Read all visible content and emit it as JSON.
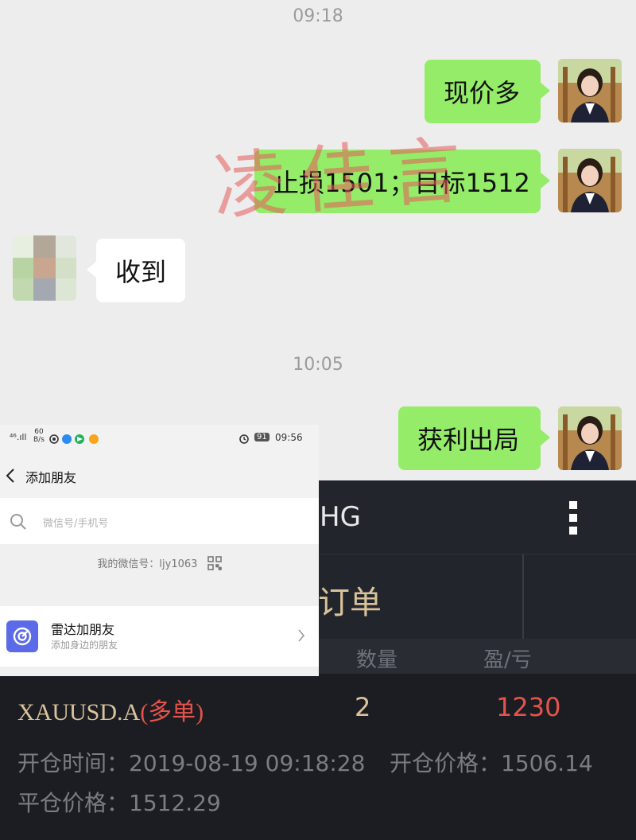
{
  "chat": {
    "time1": "09:18",
    "time2": "10:05",
    "messages": [
      {
        "side": "right",
        "text": "现价多"
      },
      {
        "side": "right",
        "text": "止损1501；目标1512"
      },
      {
        "side": "left",
        "text": "收到"
      },
      {
        "side": "right",
        "text": "获利出局"
      }
    ],
    "watermark": "凌佳言"
  },
  "phone": {
    "status": {
      "signal": "⁴⁶.ıll",
      "speed": "60",
      "speed_unit": "B/s",
      "battery": "91",
      "time": "09:56"
    },
    "nav_title": "添加朋友",
    "search_placeholder": "微信号/手机号",
    "my_wechat": "我的微信号：ljy1063",
    "radar": {
      "title": "雷达加朋友",
      "subtitle": "添加身边的朋友"
    }
  },
  "trade": {
    "header_partial": "HG",
    "tab_partial": "订单",
    "columns": {
      "qty": "数量",
      "pnl": "盈/亏"
    },
    "row": {
      "symbol": "XAUUSD.A",
      "direction": "(多单)",
      "qty": "2",
      "pnl": "1230",
      "open_time_label": "开仓时间：",
      "open_time": "2019-08-19 09:18:28",
      "open_price_label": "开仓价格：",
      "open_price": "1506.14",
      "close_price_label": "平仓价格：",
      "close_price": "1512.29"
    }
  },
  "colors": {
    "bubble": "#95ec69",
    "profit": "#e5534b",
    "gold": "#d9c39a",
    "dark": "#1c1d22"
  }
}
